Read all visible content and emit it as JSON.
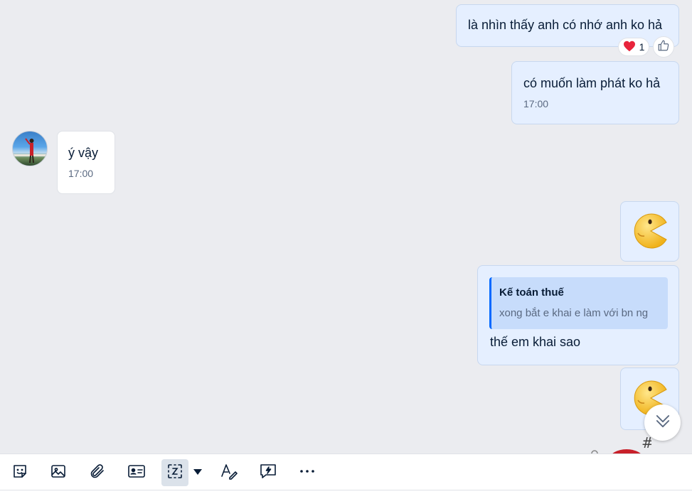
{
  "messages": [
    {
      "id": "m1",
      "direction": "out",
      "text": "là nhìn thấy anh có nhớ anh ko hả",
      "reactions": {
        "emoji": "heart",
        "count": "1"
      }
    },
    {
      "id": "m2",
      "direction": "out",
      "text": "có muốn làm phát ko hả",
      "time": "17:00"
    },
    {
      "id": "m3",
      "direction": "in",
      "text": "ý vậy",
      "time": "17:00"
    },
    {
      "id": "m4",
      "direction": "out",
      "sticker": "pacman-emoji"
    },
    {
      "id": "m5",
      "direction": "out",
      "text": "thế em khai sao",
      "quote": {
        "author": "Kế toán thuế",
        "text": "xong bắt e khai e làm với bn ng"
      }
    },
    {
      "id": "m6",
      "direction": "out",
      "sticker": "pacman-emoji"
    }
  ],
  "toolbar": {
    "items": [
      "sticker-icon",
      "image-icon",
      "attachment-icon",
      "contact-card-icon",
      "screenshot-icon",
      "screenshot-dropdown-icon",
      "format-text-icon",
      "quick-message-icon",
      "more-icon"
    ]
  },
  "colors": {
    "out_bubble": "#e5efff",
    "in_bubble": "#ffffff",
    "accent": "#0068ff",
    "background": "#ebecf0"
  }
}
